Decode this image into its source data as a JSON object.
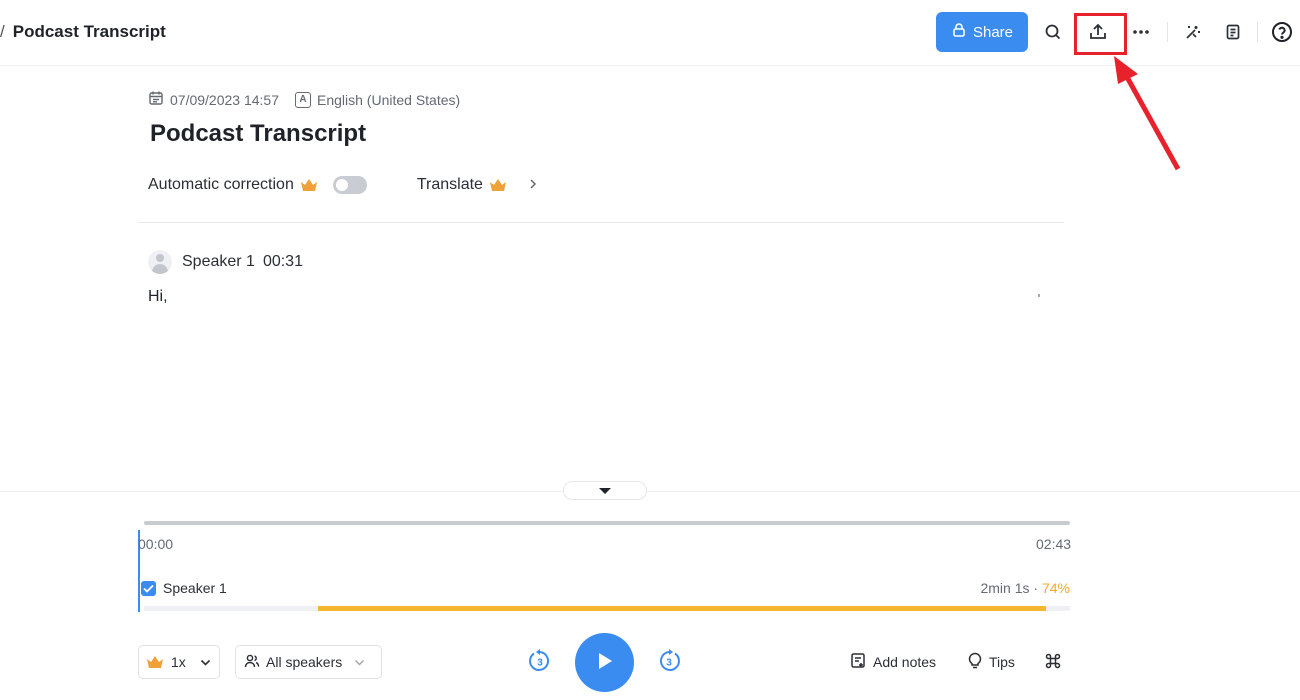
{
  "breadcrumb": {
    "separator": "/",
    "title": "Podcast Transcript"
  },
  "toolbar": {
    "share_label": "Share",
    "icons": [
      "search-icon",
      "export-icon",
      "more-icon",
      "magic-wand-icon",
      "notes-icon",
      "help-icon"
    ],
    "accent_color": "#3b8cf0",
    "highlight_color": "#e8222d"
  },
  "document": {
    "datetime": "07/09/2023 14:57",
    "language": "English (United States)",
    "language_icon_letter": "A",
    "title": "Podcast Transcript",
    "automatic_correction_label": "Automatic correction",
    "automatic_correction_enabled": false,
    "translate_label": "Translate"
  },
  "transcript": {
    "entries": [
      {
        "speaker": "Speaker 1",
        "time": "00:31",
        "text": "Hi,"
      }
    ]
  },
  "player": {
    "time_start": "00:00",
    "time_end": "02:43",
    "speakers": [
      {
        "name": "Speaker 1",
        "checked": true,
        "duration": "2min 1s",
        "separator": "·",
        "percent": "74%",
        "talk_start_fraction": 0.188,
        "talk_end_fraction": 0.974
      }
    ],
    "speed_label": "1x",
    "speaker_filter_label": "All speakers",
    "skip_back_label": "3",
    "skip_forward_label": "3",
    "add_notes_label": "Add notes",
    "tips_label": "Tips",
    "talk_color": "#f5b730"
  }
}
